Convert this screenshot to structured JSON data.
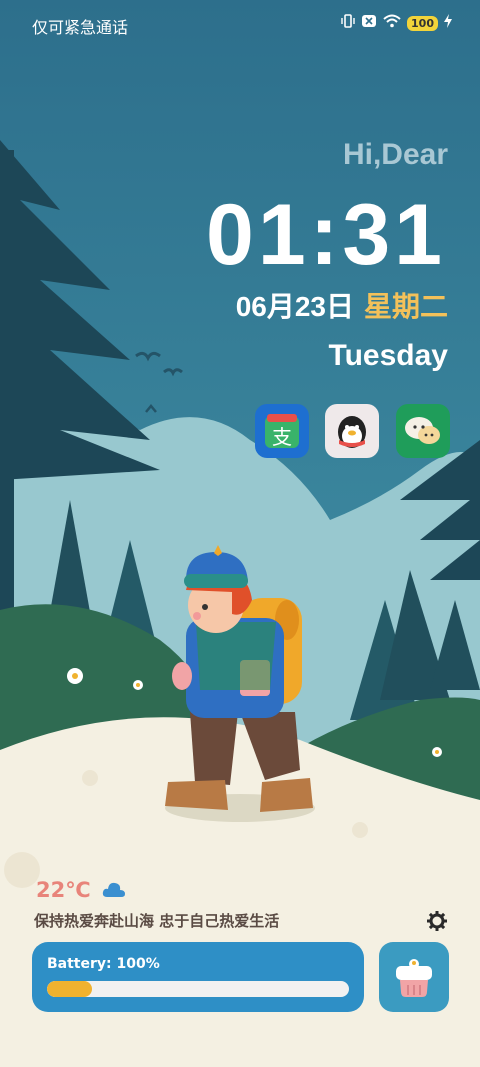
{
  "status_bar": {
    "carrier_text": "仅可紧急通话",
    "battery_level": "100"
  },
  "greeting": "Hi,Dear",
  "clock": {
    "time": "01:31"
  },
  "date": {
    "date_text": "06月23日",
    "weekday_cn": "星期二",
    "weekday_en": "Tuesday"
  },
  "apps": [
    {
      "name": "alipay",
      "icon": "alipay-icon"
    },
    {
      "name": "qq",
      "icon": "penguin-icon"
    },
    {
      "name": "wechat",
      "icon": "chat-bubble-icon"
    }
  ],
  "weather": {
    "temperature": "22℃",
    "icon": "cloud-icon"
  },
  "motto": "保持热爱奔赴山海 忠于自己热爱生活",
  "battery_card": {
    "label": "Battery: 100%",
    "fill_fraction": 0.15
  },
  "colors": {
    "accent_yellow": "#f3c15a",
    "battery_card": "#2e8fc6",
    "temp_color": "#e8847a"
  }
}
